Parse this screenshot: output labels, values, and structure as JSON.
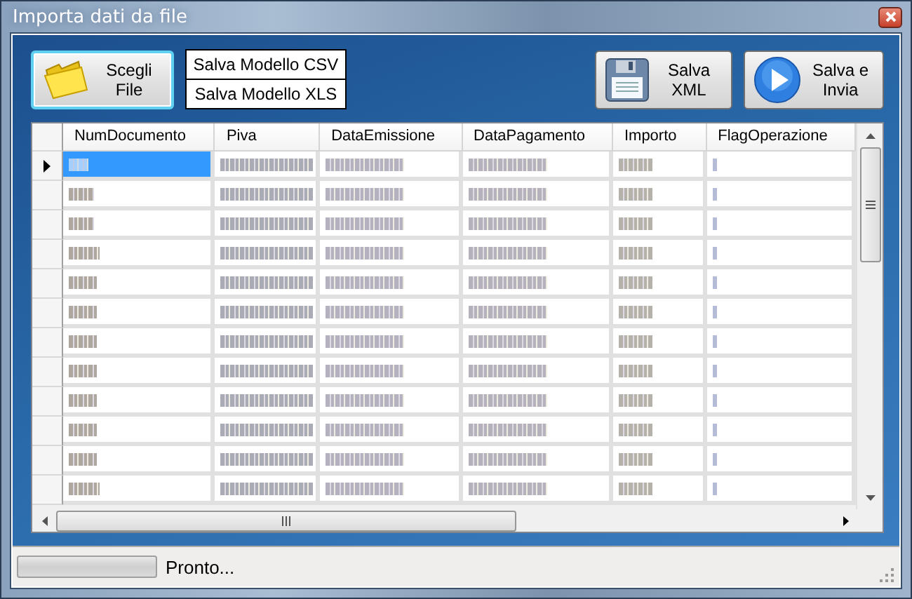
{
  "window": {
    "title": "Importa dati da file"
  },
  "toolbar": {
    "left_buttons": [
      {
        "label": "Scegli File",
        "kind": "folder",
        "focused": true
      }
    ],
    "template_buttons": [
      "Salva Modello CSV",
      "Salva Modello XLS"
    ],
    "right_buttons": [
      {
        "label": "Salva XML",
        "kind": "save",
        "focused": false
      },
      {
        "label": "Salva e Invia",
        "kind": "send",
        "focused": false
      }
    ]
  },
  "table": {
    "columns": [
      "NumDocumento",
      "Piva",
      "DataEmissione",
      "DataPagamento",
      "Importo",
      "FlagOperazione"
    ],
    "rows": [
      {
        "current": true,
        "selected": true
      },
      {
        "current": false,
        "selected": false
      },
      {
        "current": false,
        "selected": false
      },
      {
        "current": false,
        "selected": false
      },
      {
        "current": false,
        "selected": false
      },
      {
        "current": false,
        "selected": false
      },
      {
        "current": false,
        "selected": false
      },
      {
        "current": false,
        "selected": false
      },
      {
        "current": false,
        "selected": false
      },
      {
        "current": false,
        "selected": false
      },
      {
        "current": false,
        "selected": false
      },
      {
        "current": false,
        "selected": false
      }
    ]
  },
  "status_bar": {
    "progress": {
      "level": 0
    },
    "text": "Pronto..."
  }
}
